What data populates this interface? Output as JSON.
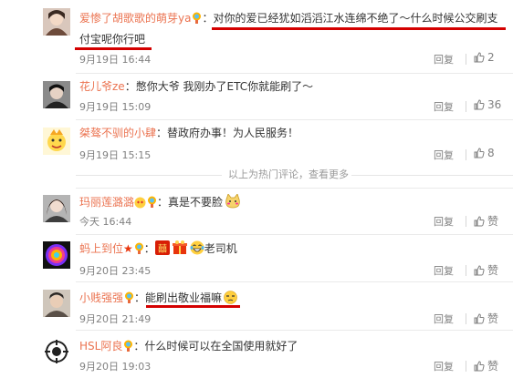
{
  "comments": [
    {
      "user": "爱惨了胡歌歌的萌芽ya",
      "text": "：对你的爱已经犹如滔滔江水连绵不绝了～什么时候公交刷支",
      "text2": "付宝呢你行吧",
      "time": "9月19日 16:44",
      "reply": "回复",
      "likes": "2"
    },
    {
      "user": "花儿爷ze",
      "text": "：憋你大爷 我刚办了ETC你就能刷了～",
      "time": "9月19日 15:09",
      "reply": "回复",
      "likes": "36"
    },
    {
      "user": "桀骜不驯的小肆",
      "text": "：替政府办事！为人民服务！",
      "time": "9月19日 15:15",
      "reply": "回复",
      "likes": "8"
    },
    {
      "user": "玛丽莲潞潞",
      "text": "：真是不要脸",
      "time": "今天 16:44",
      "reply": "回复",
      "likes": "赞"
    },
    {
      "user": "蚂上到位",
      "text": "老司机",
      "time": "9月20日 23:45",
      "reply": "回复",
      "likes": "赞"
    },
    {
      "user": "小贱强强",
      "text": "：能刷出敬业福嘛",
      "time": "9月20日 21:49",
      "reply": "回复",
      "likes": "赞"
    },
    {
      "user": "HSL阿良",
      "text": "：什么时候可以在全国使用就好了",
      "time": "9月20日 19:03",
      "reply": "回复",
      "likes": "赞"
    }
  ],
  "hot_divider": "以上为热门评论，查看更多",
  "colors": {
    "username": "#eb7350",
    "underline": "#d40000",
    "meta": "#808080"
  }
}
